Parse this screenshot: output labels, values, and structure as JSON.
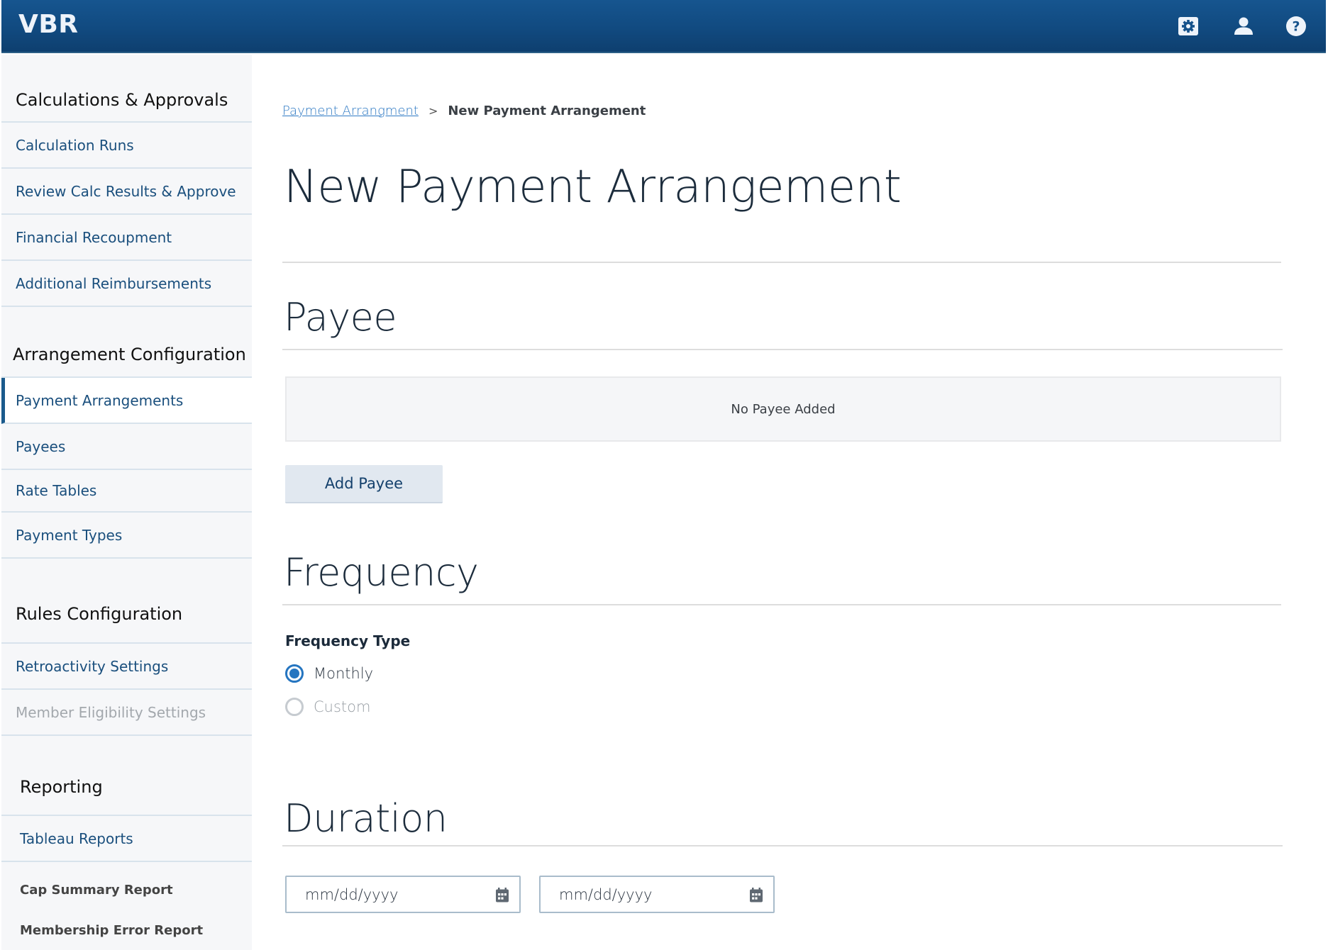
{
  "header": {
    "logo": "VBR",
    "icons": [
      {
        "name": "settings-icon"
      },
      {
        "name": "user-icon"
      },
      {
        "name": "help-icon"
      }
    ],
    "colors": {
      "bar": "#114a80",
      "icon": "#eef3fa"
    }
  },
  "sidebar": {
    "sections": [
      {
        "heading": "Calculations & Approvals",
        "items": [
          {
            "label": "Calculation Runs"
          },
          {
            "label": "Review Calc Results & Approve"
          },
          {
            "label": "Financial Recoupment"
          },
          {
            "label": "Additional Reimbursements"
          }
        ]
      },
      {
        "heading": "Arrangement Configuration",
        "items": [
          {
            "label": "Payment Arrangements",
            "active": true
          },
          {
            "label": "Payees"
          },
          {
            "label": "Rate Tables"
          },
          {
            "label": "Payment Types"
          }
        ]
      },
      {
        "heading": "Rules Configuration",
        "items": [
          {
            "label": "Retroactivity Settings"
          },
          {
            "label": "Member Eligibility Settings",
            "disabled": true
          }
        ]
      },
      {
        "heading": "Reporting",
        "items": [
          {
            "label": "Tableau Reports"
          }
        ],
        "reports": [
          {
            "label": "Cap Summary Report"
          },
          {
            "label": "Membership Error Report"
          }
        ]
      }
    ]
  },
  "breadcrumb": {
    "parent": "Payment Arrangment",
    "separator": ">",
    "current": "New Payment Arrangement"
  },
  "page": {
    "title": "New Payment Arrangement"
  },
  "payee": {
    "title": "Payee",
    "empty_text": "No Payee Added",
    "add_button": "Add Payee"
  },
  "frequency": {
    "title": "Frequency",
    "type_label": "Frequency Type",
    "options": [
      {
        "label": "Monthly",
        "selected": true
      },
      {
        "label": "Custom",
        "selected": false,
        "disabled": true
      }
    ]
  },
  "duration": {
    "title": "Duration",
    "start_placeholder": "mm/dd/yyyy",
    "end_placeholder": "mm/dd/yyyy"
  },
  "colors": {
    "accent": "#2575c0",
    "nav_text": "#1a4f7d",
    "link": "#2f7ac4"
  }
}
